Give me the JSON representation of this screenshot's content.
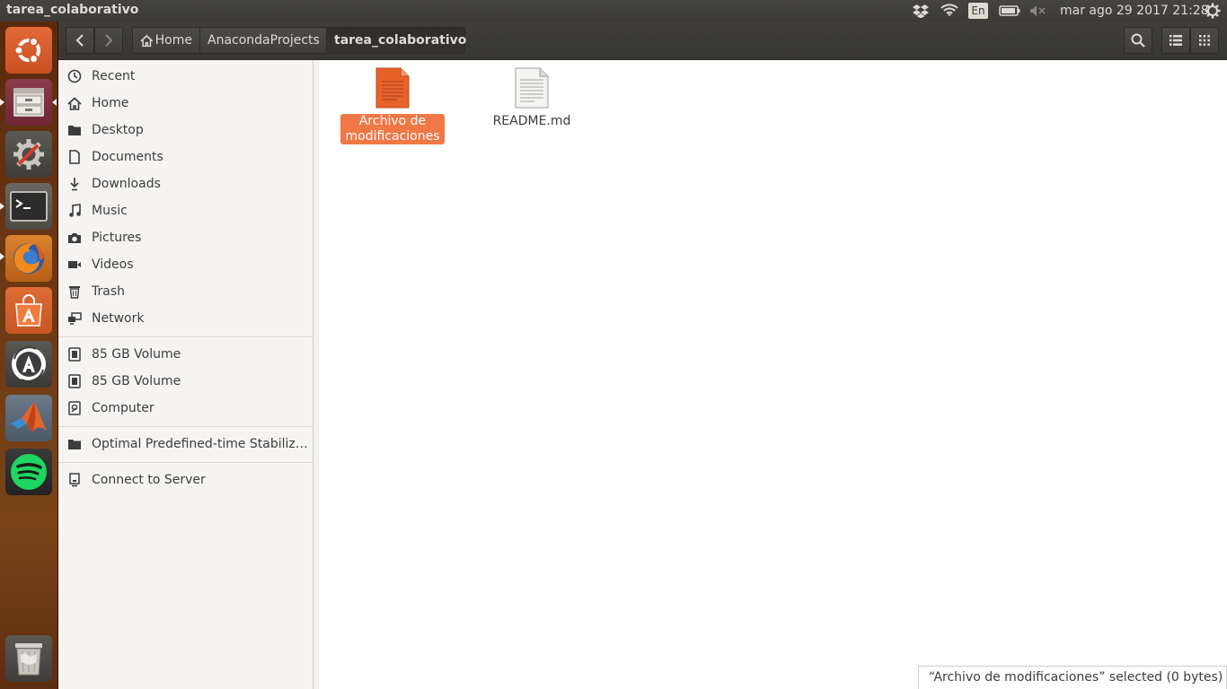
{
  "window": {
    "title": "tarea_colaborativo"
  },
  "top_panel": {
    "keyboard_layout": "En",
    "clock": "mar ago 29 2017 21:28",
    "icons": [
      "dropbox-icon",
      "wifi-icon",
      "battery-icon",
      "volume-muted-icon",
      "session-gear-icon"
    ]
  },
  "launcher": {
    "items": [
      "ubuntu-dash",
      "files",
      "system-settings",
      "terminal",
      "firefox",
      "software-center",
      "software-updater",
      "matlab",
      "spotify",
      "trash"
    ]
  },
  "header": {
    "breadcrumbs": [
      {
        "label": "Home",
        "icon": "home-icon"
      },
      {
        "label": "AnacondaProjects"
      },
      {
        "label": "tarea_colaborativo",
        "active": true
      }
    ]
  },
  "sidebar": {
    "places": [
      {
        "label": "Recent",
        "icon": "clock-icon"
      },
      {
        "label": "Home",
        "icon": "home-icon"
      },
      {
        "label": "Desktop",
        "icon": "folder-icon"
      },
      {
        "label": "Documents",
        "icon": "document-icon"
      },
      {
        "label": "Downloads",
        "icon": "download-icon"
      },
      {
        "label": "Music",
        "icon": "music-icon"
      },
      {
        "label": "Pictures",
        "icon": "camera-icon"
      },
      {
        "label": "Videos",
        "icon": "video-icon"
      },
      {
        "label": "Trash",
        "icon": "trash-icon"
      },
      {
        "label": "Network",
        "icon": "network-icon"
      }
    ],
    "devices": [
      {
        "label": "85 GB Volume",
        "icon": "drive-icon"
      },
      {
        "label": "85 GB Volume",
        "icon": "drive-icon"
      },
      {
        "label": "Computer",
        "icon": "computer-icon"
      }
    ],
    "bookmarks": [
      {
        "label": "Optimal Predefined-time Stabiliza...",
        "icon": "folder-icon"
      }
    ],
    "other": [
      {
        "label": "Connect to Server",
        "icon": "server-icon"
      }
    ]
  },
  "files": [
    {
      "name_line1": "Archivo de",
      "name_line2": "modificaciones",
      "selected": true,
      "icon": "orange-document-icon"
    },
    {
      "name_line1": "README.md",
      "name_line2": "",
      "selected": false,
      "icon": "text-file-icon"
    }
  ],
  "status": {
    "text": "“Archivo de modificaciones” selected  (0 bytes)"
  },
  "colors": {
    "accent": "#f07746",
    "panel": "#3c3b37",
    "launcher": "#6e3a14"
  }
}
